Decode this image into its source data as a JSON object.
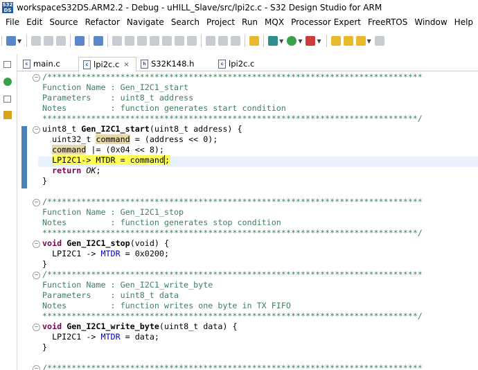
{
  "window": {
    "logo": "S32 DS",
    "title": "workspaceS32DS.ARM2.2 - Debug - uHILL_Slave/src/lpi2c.c - S32 Design Studio for ARM"
  },
  "menu": [
    "File",
    "Edit",
    "Source",
    "Refactor",
    "Navigate",
    "Search",
    "Project",
    "Run",
    "MQX",
    "Processor Expert",
    "FreeRTOS",
    "Window",
    "Help"
  ],
  "tabs": [
    {
      "label": "main.c",
      "icon": "c-file-icon"
    },
    {
      "label": "lpi2c.c",
      "icon": "c-file-icon",
      "close": "×",
      "active": true
    },
    {
      "label": "S32K148.h",
      "icon": "h-file-icon"
    },
    {
      "label": "lpi2c.c",
      "icon": "c-file-icon"
    }
  ],
  "code": {
    "l1": "/*****************************************************************************",
    "l2": "Function Name : Gen_I2C1_start",
    "l3": "Parameters    : uint8_t address",
    "l4": "Notes         : function generates start condition",
    "l5": "*****************************************************************************/",
    "l6": {
      "type": "uint8_t ",
      "name": "Gen_I2C1_start",
      "args": "(uint8_t address) {"
    },
    "l7": {
      "a": "  uint32_t ",
      "var": "command",
      "b": " = (address << 0);"
    },
    "l8": {
      "var": "command",
      "b": " |= (0x04 << 8);"
    },
    "l9": {
      "a": "LPI2C1-> MTDR = ",
      "var": "command",
      "b": ";"
    },
    "l10": {
      "kw": "return",
      "val": "OK",
      "end": ";"
    },
    "l11": "}",
    "l12": "",
    "l13": "/*****************************************************************************",
    "l14": "Function Name : Gen_I2C1_stop",
    "l15": "Notes         : function generates stop condition",
    "l16": "*****************************************************************************/",
    "l17": {
      "kw": "void",
      "name": "Gen_I2C1_stop",
      "args": "(void) {"
    },
    "l18": {
      "a": "  LPI2C1 -> ",
      "fld": "MTDR",
      "b": " = 0x0200;"
    },
    "l19": "}",
    "l20": "/*****************************************************************************",
    "l21": "Function Name : Gen_I2C1_write_byte",
    "l22": "Parameters    : uint8_t data",
    "l23": "Notes         : function writes one byte in TX FIFO",
    "l24": "*****************************************************************************/",
    "l25": {
      "kw": "void",
      "name": "Gen_I2C1_write_byte",
      "args": "(uint8_t data) {"
    },
    "l26": {
      "a": "  LPI2C1 -> ",
      "fld": "MTDR",
      "b": " = data;"
    },
    "l27": "}",
    "l28": "",
    "l29": "/*****************************************************************************"
  }
}
